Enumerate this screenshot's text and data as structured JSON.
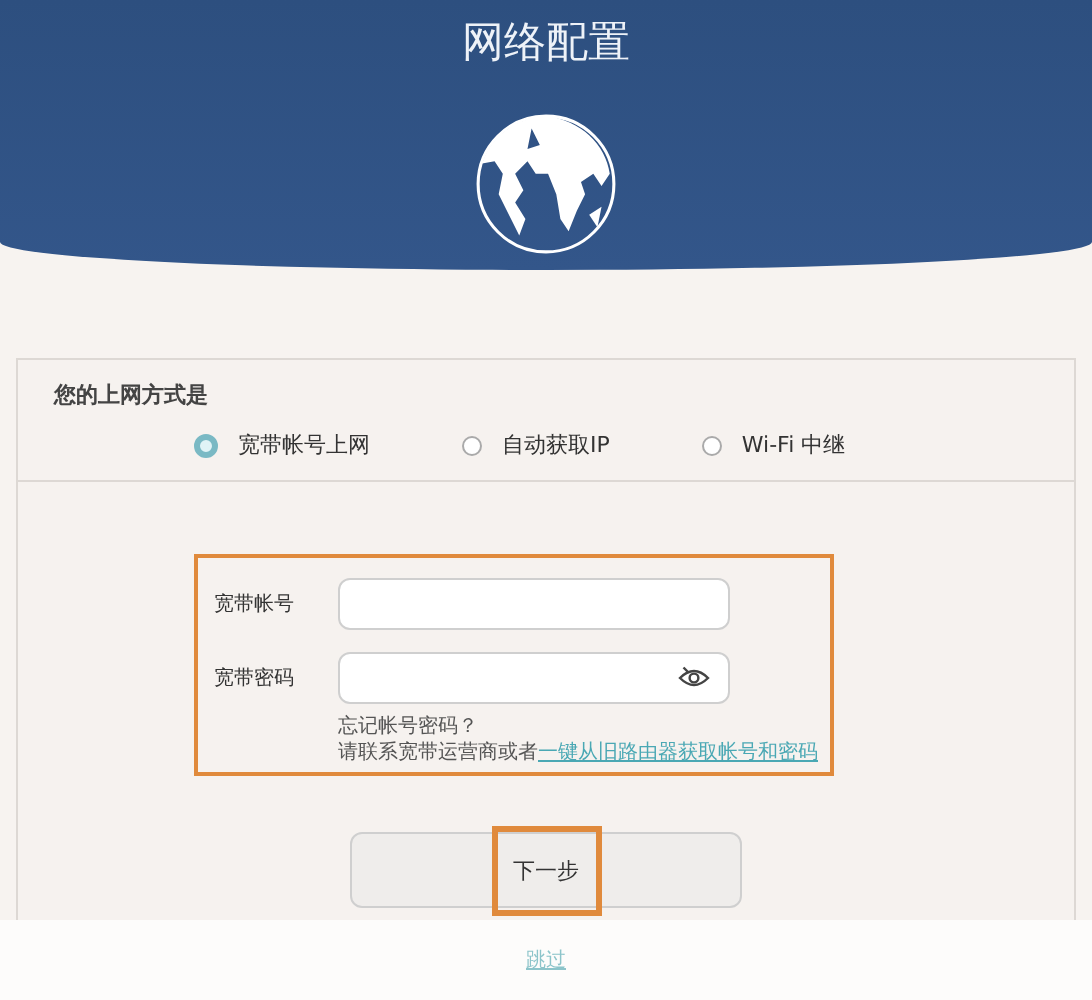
{
  "header": {
    "title": "网络配置"
  },
  "connection": {
    "label": "您的上网方式是",
    "options": [
      {
        "label": "宽带帐号上网",
        "selected": true
      },
      {
        "label": "自动获取IP",
        "selected": false
      },
      {
        "label": "Wi-Fi 中继",
        "selected": false
      }
    ]
  },
  "form": {
    "highlighted": true,
    "fields": [
      {
        "label": "宽带帐号",
        "kind": "text"
      },
      {
        "label": "宽带密码",
        "kind": "password"
      }
    ],
    "help": "忘记帐号密码？",
    "hint": "请联系宽带运营商或者",
    "hint_link": "一键从旧路由器获取帐号和密码"
  },
  "next_button": {
    "label": "下一步",
    "highlighted": true
  },
  "skip_link": "跳过"
}
